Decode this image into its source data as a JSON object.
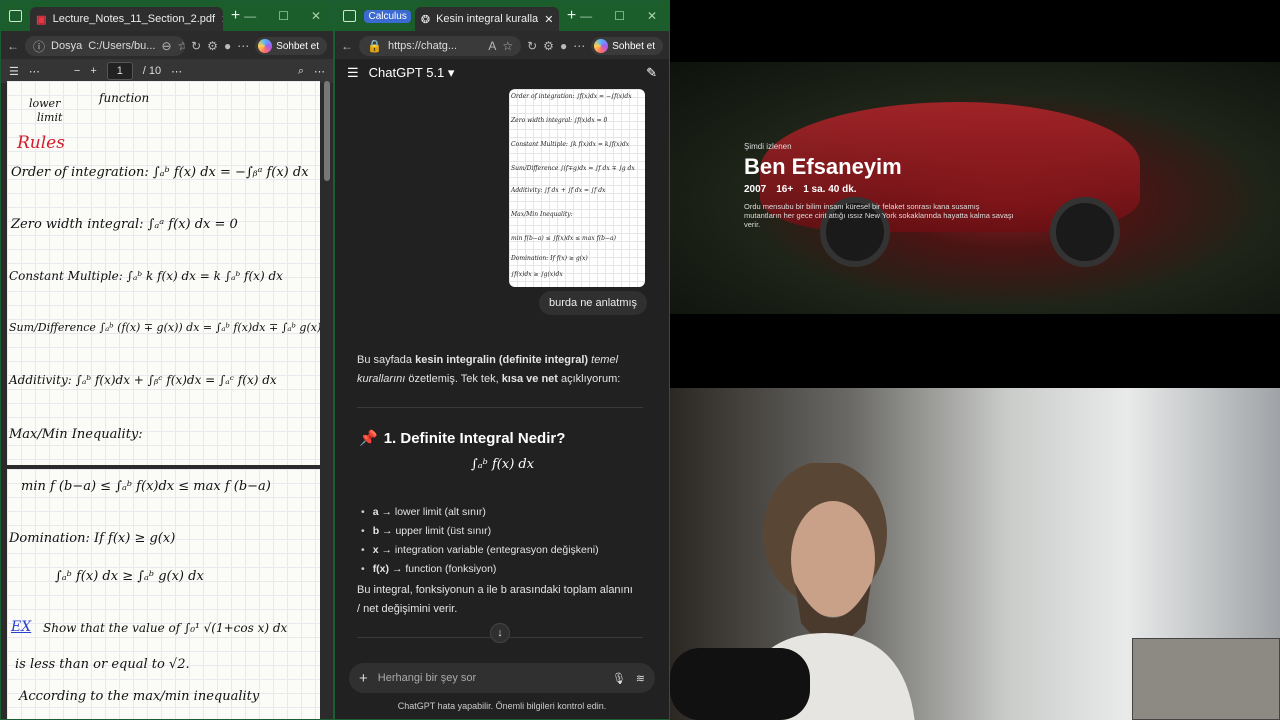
{
  "w1": {
    "tab_title": "Lecture_Notes_11_Section_2.pdf",
    "address_label": "Dosya",
    "address_url": "C:/Users/bu...",
    "sohbet": "Sohbet et",
    "page_current": "1",
    "page_total": "/ 10",
    "notes": {
      "l1": "lower",
      "l2": "limit",
      "l3": "function",
      "rules": "Rules",
      "r1": "Order of integration: ∫ₐᵇ f(x) dx = −∫ᵦᵃ f(x) dx",
      "r2": "Zero width integral: ∫ₐᵃ f(x) dx = 0",
      "r3": "Constant Multiple: ∫ₐᵇ k f(x) dx = k ∫ₐᵇ f(x) dx",
      "r4": "Sum/Difference ∫ₐᵇ (f(x) ∓ g(x)) dx = ∫ₐᵇ f(x)dx ∓ ∫ₐᵇ g(x)dx",
      "r5": "Additivity: ∫ₐᵇ f(x)dx + ∫ᵦᶜ f(x)dx = ∫ₐᶜ f(x) dx",
      "r6": "Max/Min Inequality:",
      "r7": "min f (b−a) ≤ ∫ₐᵇ f(x)dx ≤ max f (b−a)",
      "r8": "Domination: If  f(x) ≥ g(x)",
      "r9": "∫ₐᵇ f(x) dx ≥ ∫ₐᵇ g(x) dx",
      "ex": "EX",
      "r10": "Show that the value of ∫₀¹ √(1+cos x) dx",
      "r11": "is less than or equal to √2.",
      "r12": "According to the max/min inequality"
    }
  },
  "w2": {
    "tab_pill": "Calculus",
    "tab_title": "Kesin integral kuralla",
    "address_url": "https://chatg...",
    "sohbet": "Sohbet et",
    "model": "ChatGPT 5.1",
    "thumb": {
      "t1": "Order of integration: ∫f(x)dx = −∫f(x)dx",
      "t2": "Zero width integral: ∫f(x)dx = 0",
      "t3": "Constant Multiple: ∫k f(x)dx = k∫f(x)dx",
      "t4": "Sum/Difference ∫(f∓g)dx = ∫f dx ∓ ∫g dx",
      "t5": "Additivity: ∫f dx + ∫f dx = ∫f dx",
      "t6": "Max/Min Inequality:",
      "t7": "min f(b−a) ≤ ∫f(x)dx ≤ max f(b−a)",
      "t8": "Domination: If f(x) ≥ g(x)",
      "t9": "∫f(x)dx ≥ ∫g(x)dx"
    },
    "user_msg": "burda ne anlatmış",
    "intro_a": "Bu sayfada ",
    "intro_b": "kesin integralin (definite integral)",
    "intro_c": " temel kurallarını",
    "intro_d": " özetlemiş. Tek tek, ",
    "intro_e": "kısa ve net",
    "intro_f": " açıklıyorum:",
    "heading_icon": "📌",
    "heading": "1. Definite Integral Nedir?",
    "math": "∫ₐᵇ f(x) dx",
    "bullets": [
      {
        "k": "a",
        "v": " → lower limit (alt sınır)"
      },
      {
        "k": "b",
        "v": " → upper limit (üst sınır)"
      },
      {
        "k": "x",
        "v": " → integration variable (entegrasyon değişkeni)"
      },
      {
        "k": "f(x)",
        "v": " → function (fonksiyon)"
      }
    ],
    "para2": "Bu integral, fonksiyonun a ile b arasındaki toplam alanını / net değişimini verir.",
    "input_placeholder": "Herhangi bir şey sor",
    "footer": "ChatGPT hata yapabilir. Önemli bilgileri kontrol edin."
  },
  "movie": {
    "now_watching": "Şimdi izlenen",
    "title": "Ben Efsaneyim",
    "year": "2007",
    "rating": "16+",
    "duration": "1 sa. 40 dk.",
    "desc": "Ordu mensubu bir bilim insanı küresel bir felaket sonrası kana susamış mutantların her gece cirit attığı ıssız New York sokaklarında hayatta kalma savaşı verir."
  }
}
